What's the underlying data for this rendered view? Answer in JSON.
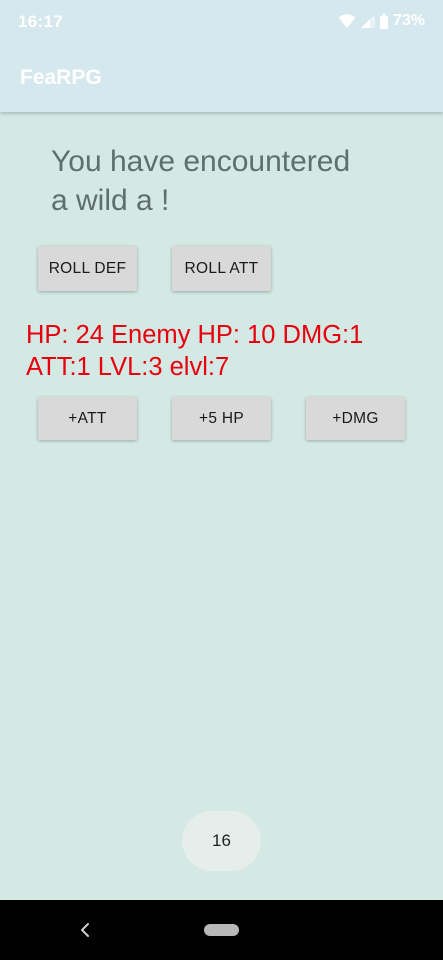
{
  "status_bar": {
    "time": "16:17",
    "battery": "73%",
    "icons": [
      "wifi-icon",
      "signal-icon",
      "battery-icon"
    ]
  },
  "app_bar": {
    "title": "FeaRPG"
  },
  "main": {
    "message_line1": "You have encountered",
    "message_line2": "a wild a !",
    "roll_buttons": {
      "roll_def": "ROLL DEF",
      "roll_att": "ROLL ATT"
    },
    "stats_line1": "HP: 24 Enemy HP: 10 DMG:1",
    "stats_line2": "ATT:1 LVL:3 elvl:7",
    "upgrade_buttons": {
      "att": "+ATT",
      "hp": "+5 HP",
      "dmg": "+DMG"
    },
    "counter": "16"
  },
  "nav_bar": {
    "icons": [
      "back-icon",
      "home-icon"
    ]
  },
  "colors": {
    "background": "#d4e8e4",
    "app_bar": "#d5e8ee",
    "stats_text": "#e8000e",
    "button": "#d9d9d9"
  }
}
